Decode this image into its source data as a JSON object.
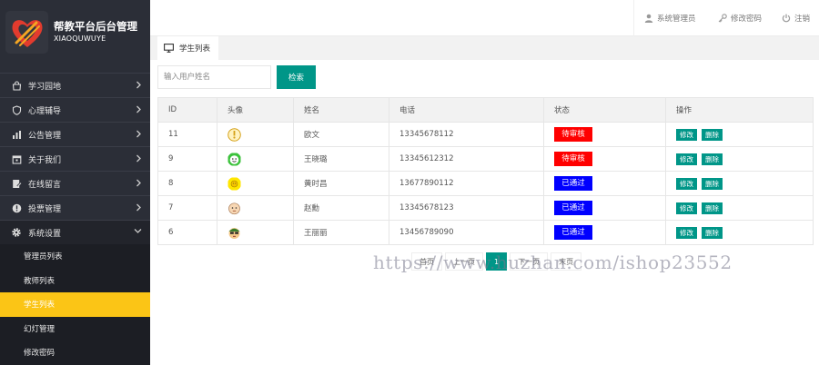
{
  "brand": {
    "title": "帮教平台后台管理",
    "subtitle": "XIAOQUWUYE"
  },
  "header": {
    "admin_label": "系统管理员",
    "change_password_label": "修改密码",
    "logout_label": "注销"
  },
  "sidebar": {
    "items": [
      {
        "label": "学习园地",
        "icon": "shopping-bag-icon"
      },
      {
        "label": "心理辅导",
        "icon": "shield-icon"
      },
      {
        "label": "公告管理",
        "icon": "bar-chart-icon"
      },
      {
        "label": "关于我们",
        "icon": "calendar-icon"
      },
      {
        "label": "在线留言",
        "icon": "message-icon"
      },
      {
        "label": "投票管理",
        "icon": "info-icon"
      },
      {
        "label": "系统设置",
        "icon": "gear-icon"
      }
    ],
    "sub_items": [
      {
        "label": "管理员列表"
      },
      {
        "label": "教师列表"
      },
      {
        "label": "学生列表"
      },
      {
        "label": "幻灯管理"
      },
      {
        "label": "修改密码"
      }
    ]
  },
  "tab": {
    "label": "学生列表"
  },
  "search": {
    "placeholder": "输入用户姓名",
    "button_label": "检索"
  },
  "table": {
    "headers": [
      "ID",
      "头像",
      "姓名",
      "电话",
      "状态",
      "操作"
    ],
    "rows": [
      {
        "id": "11",
        "name": "欧文",
        "phone": "13345678112",
        "status": "待审核",
        "avatar": "alarm-avatar"
      },
      {
        "id": "9",
        "name": "王晓璐",
        "phone": "13345612312",
        "status": "待审核",
        "avatar": "smile-avatar"
      },
      {
        "id": "8",
        "name": "黄时昌",
        "phone": "13677890112",
        "status": "已通过",
        "avatar": "sun-avatar"
      },
      {
        "id": "7",
        "name": "赵勳",
        "phone": "13345678123",
        "status": "已通过",
        "avatar": "face-avatar"
      },
      {
        "id": "6",
        "name": "王丽丽",
        "phone": "13456789090",
        "status": "已通过",
        "avatar": "glasses-avatar"
      }
    ],
    "edit_label": "修改",
    "delete_label": "删除"
  },
  "pager": {
    "first": "首页",
    "prev": "上一页",
    "current": "1",
    "next": "下一页",
    "last": "末页"
  },
  "watermark": "https://www.huzhan.com/ishop23552",
  "colors": {
    "sidebar_bg": "#2b2e37",
    "accent": "#009688",
    "active_sub": "#fbc516",
    "status_pending": "#ff0000",
    "status_passed": "#0000ff"
  }
}
